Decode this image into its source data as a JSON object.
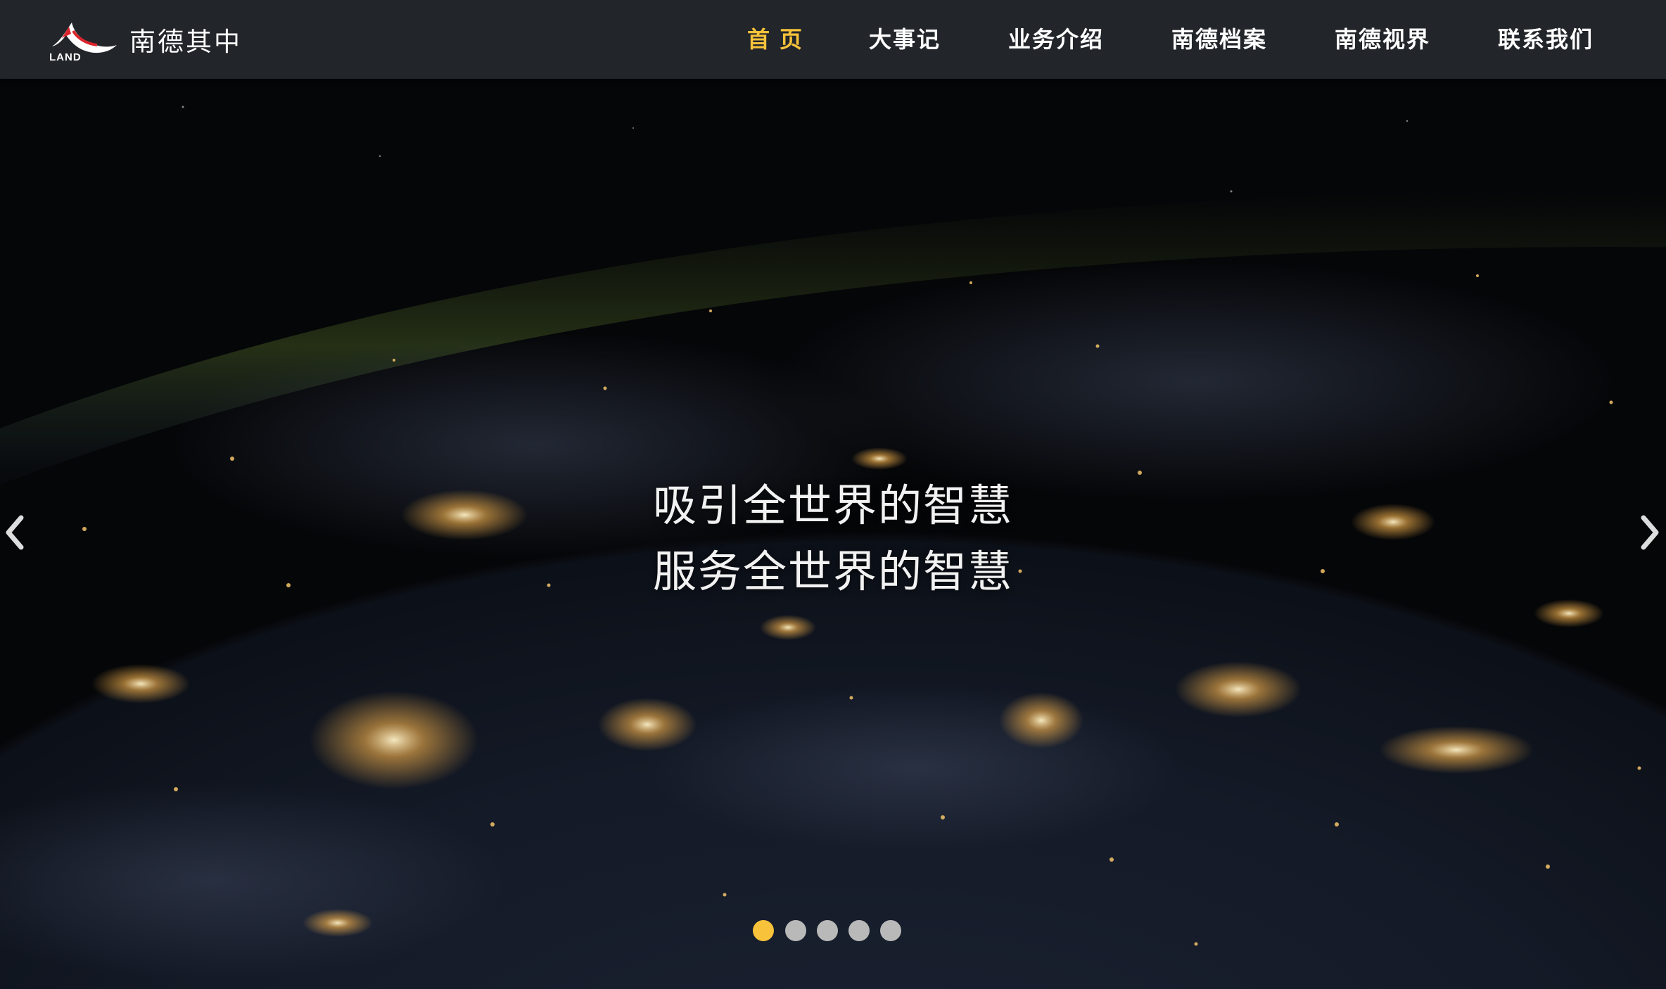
{
  "brand": {
    "name": "南德其中",
    "logo_text": "LAND"
  },
  "nav": {
    "items": [
      {
        "label": "首页",
        "active": true
      },
      {
        "label": "大事记",
        "active": false
      },
      {
        "label": "业务介绍",
        "active": false
      },
      {
        "label": "南德档案",
        "active": false
      },
      {
        "label": "南德视界",
        "active": false
      },
      {
        "label": "联系我们",
        "active": false
      }
    ]
  },
  "hero": {
    "line1": "吸引全世界的智慧",
    "line2": "服务全世界的智慧",
    "prev_icon": "chevron-left-icon",
    "next_icon": "chevron-right-icon",
    "slide_count": 5,
    "active_slide": 1
  },
  "colors": {
    "header_bg": "#22252a",
    "accent": "#f8c23a",
    "dot_inactive": "#b9b9b9",
    "text": "#ffffff"
  }
}
